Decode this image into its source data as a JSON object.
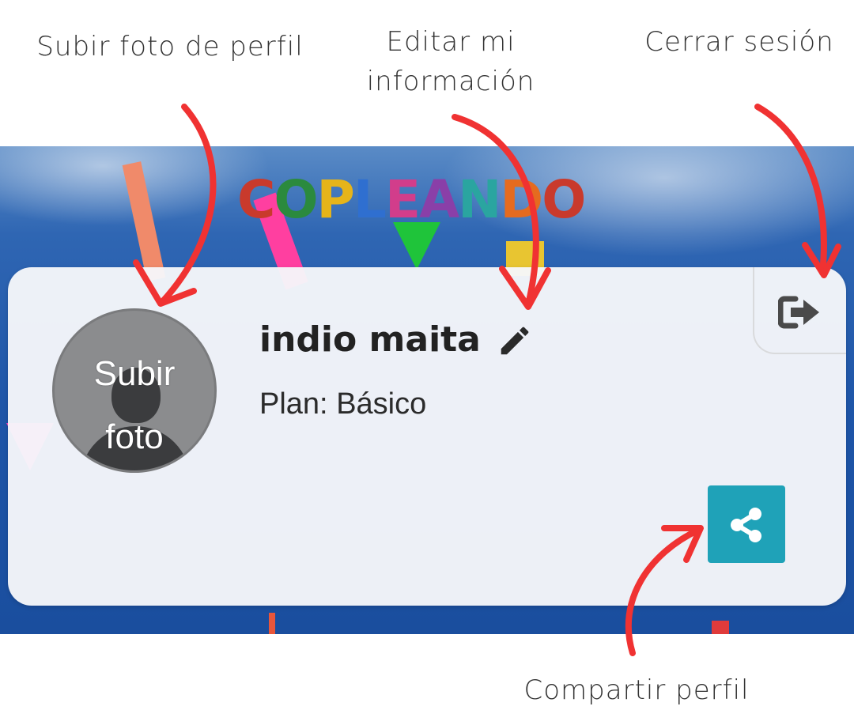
{
  "annotations": {
    "upload_photo": "Subir foto de perfil",
    "edit_info": "Editar mi\ninformación",
    "edit_info_line1": "Editar mi",
    "edit_info_line2": "información",
    "logout": "Cerrar sesión",
    "share_profile": "Compartir perfil"
  },
  "banner": {
    "logo_text": "COPLEANDO",
    "logo_colors": [
      "#c93a2c",
      "#2b8a3e",
      "#e6b41a",
      "#2f6fd0",
      "#d23d8b",
      "#8a3fa8",
      "#2aa5a0",
      "#e56b1f",
      "#c93a2c"
    ]
  },
  "profile": {
    "avatar_label_line1": "Subir",
    "avatar_label_line2": "foto",
    "name": "indio maita",
    "plan_label": "Plan:",
    "plan_value": "Básico"
  },
  "icons": {
    "edit": "pencil-icon",
    "logout": "sign-out-icon",
    "share": "share-icon",
    "avatar": "user-silhouette-icon"
  },
  "colors": {
    "accent_share": "#1fa2b8",
    "annotation_arrow": "#f03232",
    "card_background": "#f6f7fa"
  }
}
